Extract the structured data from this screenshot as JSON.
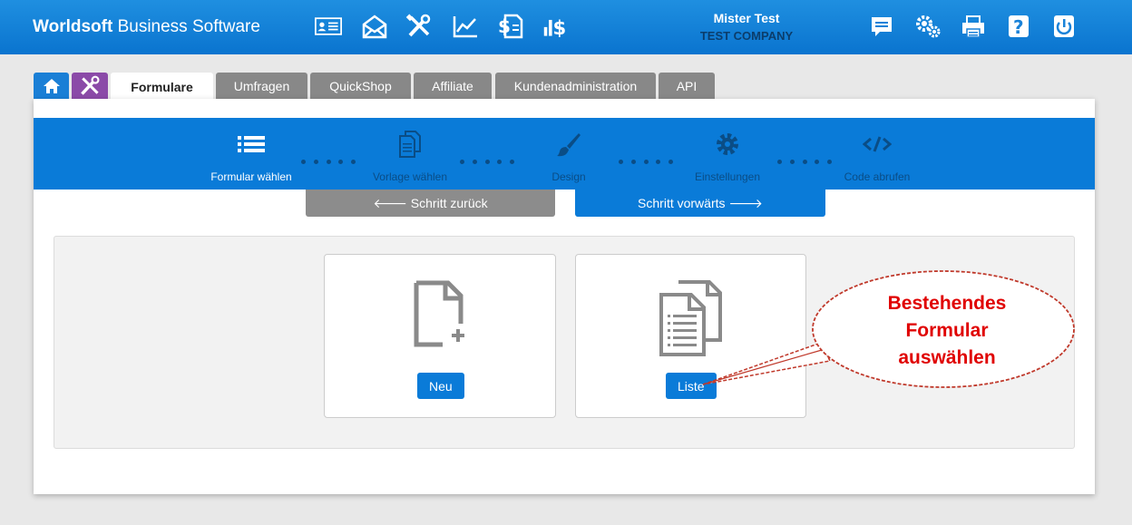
{
  "header": {
    "brand_bold": "Worldsoft",
    "brand_rest": " Business Software",
    "user_name": "Mister Test",
    "company": "TEST COMPANY",
    "left_icons": [
      "id-card-icon",
      "envelope-icon",
      "tools-icon",
      "line-chart-icon",
      "dollar-document-icon",
      "bar-dollar-icon"
    ],
    "right_icons": [
      "chat-icon",
      "gears-icon",
      "printer-icon",
      "help-icon",
      "power-icon"
    ]
  },
  "tabs": [
    {
      "id": "home",
      "label": ""
    },
    {
      "id": "tools",
      "label": ""
    },
    {
      "id": "formulare",
      "label": "Formulare"
    },
    {
      "id": "umfragen",
      "label": "Umfragen"
    },
    {
      "id": "quickshop",
      "label": "QuickShop"
    },
    {
      "id": "affiliate",
      "label": "Affiliate"
    },
    {
      "id": "kundenadministration",
      "label": "Kundenadministration"
    },
    {
      "id": "api",
      "label": "API"
    }
  ],
  "wizard": {
    "steps": [
      {
        "label": "Formular wählen",
        "icon": "list-icon",
        "active": true
      },
      {
        "label": "Vorlage wählen",
        "icon": "documents-icon",
        "active": false
      },
      {
        "label": "Design",
        "icon": "brush-icon",
        "active": false
      },
      {
        "label": "Einstellungen",
        "icon": "gear-icon",
        "active": false
      },
      {
        "label": "Code abrufen",
        "icon": "code-icon",
        "active": false
      }
    ],
    "back_label": "🡐 Schritt zurück",
    "forward_label": "Schritt vorwärts 🡒"
  },
  "cards": {
    "new_label": "Neu",
    "list_label": "Liste"
  },
  "callout": {
    "line1": "Bestehendes",
    "line2": "Formular",
    "line3": "auswählen",
    "color": "#e00000"
  },
  "colors": {
    "primary": "#0a7bd8",
    "header_top": "#1f8fe0",
    "tools_tab": "#8b4aa8",
    "inactive_tab": "#888888"
  }
}
